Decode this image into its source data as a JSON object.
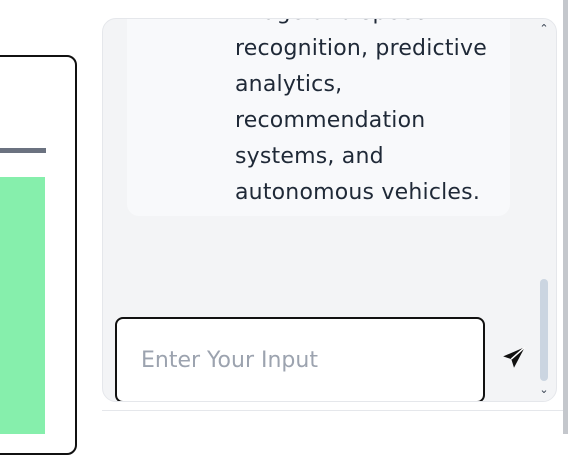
{
  "chat": {
    "message_lines": [
      "image and speech",
      "recognition, predictive",
      "analytics,",
      "recommendation",
      "systems, and",
      "autonomous vehicles."
    ],
    "input_placeholder": "Enter Your Input",
    "input_value": ""
  },
  "icons": {
    "send": "send-paper-plane-icon",
    "scroll_up": "chevron-up-icon",
    "scroll_down": "chevron-down-icon"
  },
  "colors": {
    "left_card_green": "#86efac",
    "panel_bg": "#f3f4f6",
    "input_border": "#111111",
    "placeholder": "#9ca3af"
  }
}
